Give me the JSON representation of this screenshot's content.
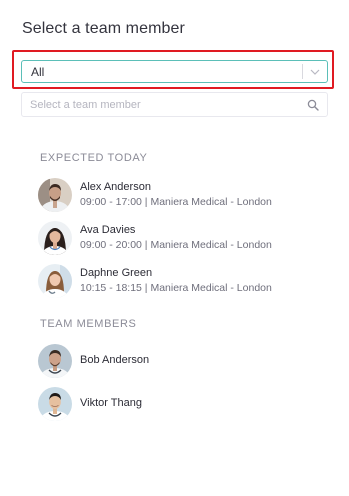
{
  "title": "Select a team member",
  "select": {
    "value": "All",
    "icon": "chevron-down-icon"
  },
  "search": {
    "placeholder": "Select a team member",
    "icon": "search-icon"
  },
  "expected_today": {
    "heading": "EXPECTED TODAY",
    "people": [
      {
        "name": "Alex Anderson",
        "detail": "09:00 - 17:00 | Maniera Medical - London"
      },
      {
        "name": "Ava Davies",
        "detail": "09:00 - 20:00 | Maniera Medical - London"
      },
      {
        "name": "Daphne Green",
        "detail": "10:15 - 18:15 | Maniera Medical - London"
      }
    ]
  },
  "team_members": {
    "heading": "TEAM MEMBERS",
    "people": [
      {
        "name": "Bob Anderson"
      },
      {
        "name": "Viktor Thang"
      }
    ]
  },
  "colors": {
    "accent_border": "#5bbfb8",
    "highlight": "#e01a22"
  }
}
